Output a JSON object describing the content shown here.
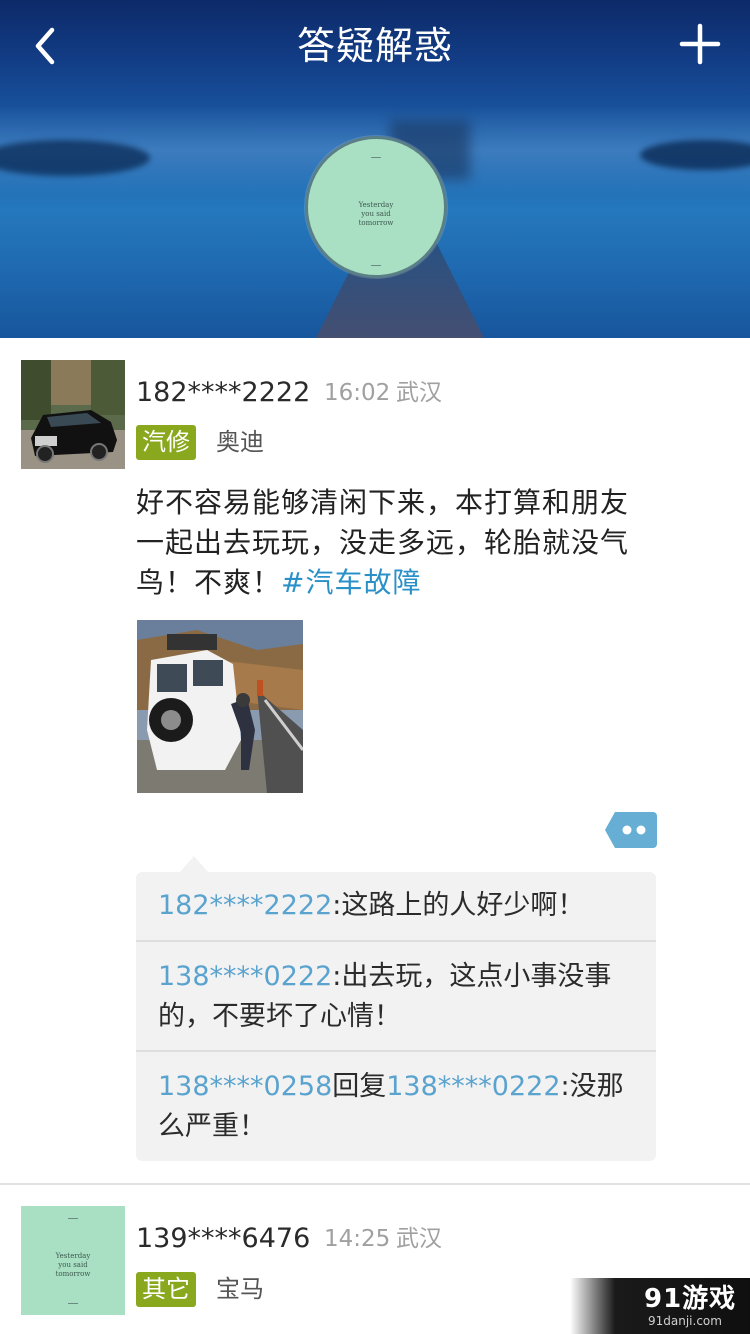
{
  "header": {
    "title": "答疑解惑",
    "back_icon": "chevron-left-icon",
    "add_icon": "plus-icon",
    "profile_avatar_text": [
      "Yesterday",
      "you said",
      "tomorrow"
    ]
  },
  "posts": [
    {
      "username": "182****2222",
      "time": "16:02",
      "location": "武汉",
      "tag": "汽修",
      "brand": "奥迪",
      "content_text": "好不容易能够清闲下来，本打算和朋友一起出去玩玩，没走多远，轮胎就没气鸟！不爽！",
      "hashtag": "#汽车故障",
      "comments": [
        {
          "user": "182****2222",
          "text": ":这路上的人好少啊！"
        },
        {
          "user": "138****0222",
          "text": ":出去玩，这点小事没事的，不要坏了心情！"
        },
        {
          "user": "138****0258",
          "reply_word": "回复",
          "reply_to": "138****0222",
          "text": ":没那么严重！"
        }
      ]
    },
    {
      "username": "139****6476",
      "time": "14:25",
      "location": "武汉",
      "tag": "其它",
      "brand": "宝马",
      "avatar_text": [
        "Yesterday",
        "you said",
        "tomorrow"
      ]
    }
  ],
  "watermark": {
    "logo": "91游戏",
    "url": "91danji.com"
  },
  "colors": {
    "tag_green": "#8aa81e",
    "link_blue": "#2a90c8",
    "comment_user_blue": "#5aa3cf",
    "comment_btn_blue": "#66aed3",
    "avatar_mint": "#a9dfc2"
  }
}
